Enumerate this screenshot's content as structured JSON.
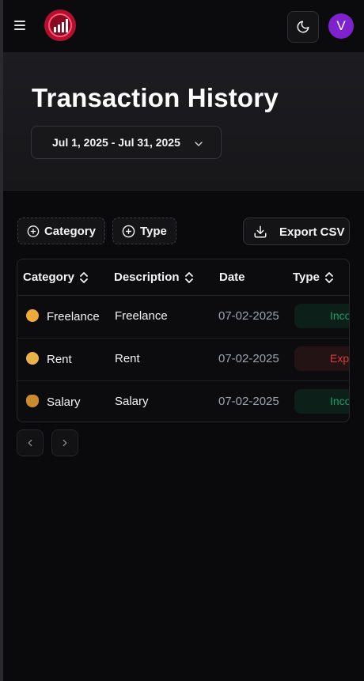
{
  "header": {
    "menu_icon": "hamburger-menu-icon",
    "logo_icon": "bar-chart-logo-icon",
    "theme_icon": "moon-icon",
    "avatar_initial": "V",
    "accent_color": "#b2102e",
    "avatar_color": "#7e22ce"
  },
  "page": {
    "title": "Transaction History",
    "date_range": "Jul 1, 2025 - Jul 31, 2025"
  },
  "filters": {
    "category_label": "Category",
    "type_label": "Type",
    "export_label": "Export CSV"
  },
  "table": {
    "columns": [
      "Category",
      "Description",
      "Date",
      "Type"
    ],
    "rows": [
      {
        "category": "Freelance",
        "emoji": "freelance-emoji-icon",
        "description": "Freelance",
        "date": "07-02-2025",
        "type": "Income"
      },
      {
        "category": "Rent",
        "emoji": "rent-emoji-icon",
        "description": "Rent",
        "date": "07-02-2025",
        "type": "Expense"
      },
      {
        "category": "Salary",
        "emoji": "money-bag-emoji-icon",
        "description": "Salary",
        "date": "07-02-2025",
        "type": "Income"
      }
    ],
    "income_color": "#1aa06a",
    "expense_color": "#dc3b3b"
  },
  "pagination": {
    "prev_icon": "chevron-left-icon",
    "next_icon": "chevron-right-icon"
  }
}
